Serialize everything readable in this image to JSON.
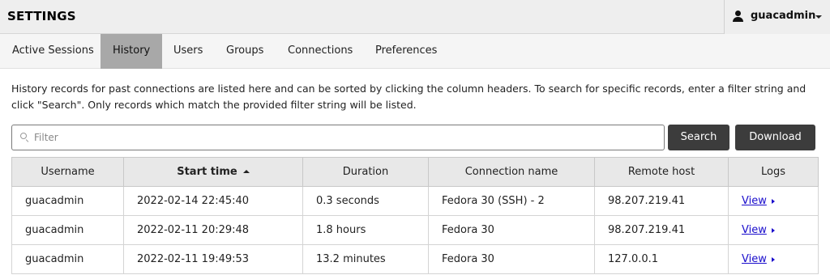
{
  "header": {
    "title": "SETTINGS",
    "user": {
      "name": "guacadmin",
      "icon": "user-icon"
    }
  },
  "tabs": [
    {
      "label": "Active Sessions",
      "active": false
    },
    {
      "label": "History",
      "active": true
    },
    {
      "label": "Users",
      "active": false
    },
    {
      "label": "Groups",
      "active": false
    },
    {
      "label": "Connections",
      "active": false
    },
    {
      "label": "Preferences",
      "active": false
    }
  ],
  "description": "History records for past connections are listed here and can be sorted by clicking the column headers. To search for specific records, enter a filter string and click \"Search\". Only records which match the provided filter string will be listed.",
  "filter": {
    "placeholder": "Filter",
    "value": ""
  },
  "buttons": {
    "search": "Search",
    "download": "Download"
  },
  "table": {
    "columns": [
      "Username",
      "Start time",
      "Duration",
      "Connection name",
      "Remote host",
      "Logs"
    ],
    "sorted_column": "Start time",
    "rows": [
      {
        "username": "guacadmin",
        "start_time": "2022-02-14 22:45:40",
        "duration": "0.3 seconds",
        "connection_name": "Fedora 30 (SSH) - 2",
        "remote_host": "98.207.219.41",
        "logs": "View"
      },
      {
        "username": "guacadmin",
        "start_time": "2022-02-11 20:29:48",
        "duration": "1.8 hours",
        "connection_name": "Fedora 30",
        "remote_host": "98.207.219.41",
        "logs": "View"
      },
      {
        "username": "guacadmin",
        "start_time": "2022-02-11 19:49:53",
        "duration": "13.2 minutes",
        "connection_name": "Fedora 30",
        "remote_host": "127.0.0.1",
        "logs": "View"
      }
    ]
  },
  "colors": {
    "button_bg": "#3c3c3c",
    "active_tab_bg": "#a8a8a8",
    "link": "#1a0dcc"
  }
}
